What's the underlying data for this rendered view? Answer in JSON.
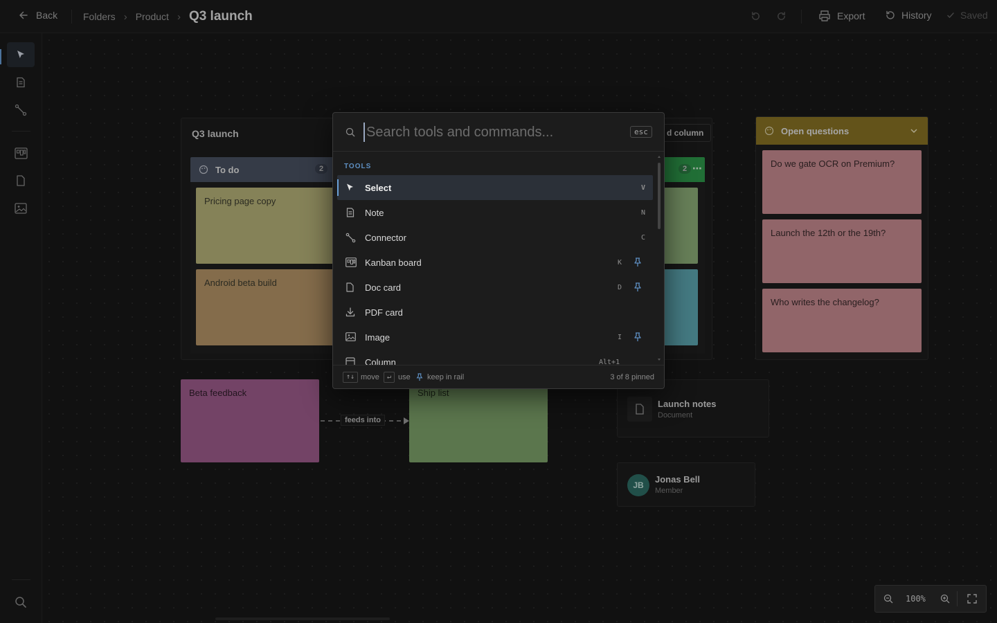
{
  "header": {
    "back_label": "Back",
    "breadcrumb": [
      "Folders",
      "Product"
    ],
    "current": "Q3 launch",
    "export_label": "Export",
    "history_label": "History",
    "saved_label": "Saved"
  },
  "board": {
    "frame_title": "Q3 launch",
    "columns": [
      {
        "title": "To do",
        "count": "2",
        "color": "#4a5263"
      },
      {
        "title": "",
        "count": "2",
        "color": "#2f9a4c"
      }
    ],
    "add_column_label": "d column",
    "todo_cards": [
      "Pricing page copy",
      "Android beta build"
    ],
    "open_questions": {
      "title": "Open questions",
      "color": "#8a7424",
      "cards": [
        "Do we gate OCR on Premium?",
        "Launch the 12th or the 19th?",
        "Who writes the changelog?"
      ]
    },
    "stickies": [
      {
        "text": "Beta feedback",
        "color": "#a05d8e"
      },
      {
        "text": "Ship list",
        "color": "#7ea46b"
      }
    ],
    "connector_label": "feeds into",
    "doc_card": {
      "title": "Launch notes",
      "subtitle": "Document"
    },
    "member_card": {
      "initials": "JB",
      "name": "Jonas Bell",
      "role": "Member",
      "color": "#2f6e66"
    }
  },
  "palette": {
    "placeholder": "Search tools and commands...",
    "esc_label": "esc",
    "section_label": "TOOLS",
    "items": [
      {
        "label": "Select",
        "shortcut": "V",
        "pinned": false,
        "icon": "cursor-icon",
        "selected": true
      },
      {
        "label": "Note",
        "shortcut": "N",
        "pinned": false,
        "icon": "note-icon"
      },
      {
        "label": "Connector",
        "shortcut": "C",
        "pinned": false,
        "icon": "connector-icon"
      },
      {
        "label": "Kanban board",
        "shortcut": "K",
        "pinned": true,
        "icon": "kanban-icon"
      },
      {
        "label": "Doc card",
        "shortcut": "D",
        "pinned": true,
        "icon": "doc-icon"
      },
      {
        "label": "PDF card",
        "shortcut": "",
        "pinned": false,
        "icon": "download-icon"
      },
      {
        "label": "Image",
        "shortcut": "I",
        "pinned": true,
        "icon": "image-icon"
      },
      {
        "label": "Column",
        "shortcut": "Alt+1",
        "pinned": false,
        "icon": "column-icon"
      }
    ],
    "footer": {
      "move_key": "↑↓",
      "move_label": "move",
      "use_key": "↵",
      "use_label": "use",
      "pin_label": "keep in rail",
      "pinned_count": "3 of 8 pinned"
    }
  },
  "zoom": {
    "level": "100%"
  }
}
